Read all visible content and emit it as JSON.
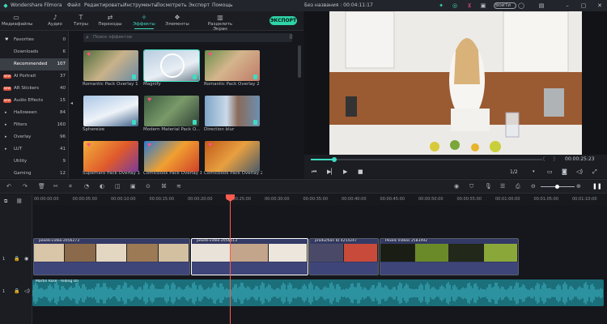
{
  "app": {
    "name": "Wondershare Filmora",
    "logo": "filmora-logo-icon"
  },
  "menu": [
    "Файл",
    "Редактировать",
    "Инструменты",
    "Посмотреть",
    "Экспорт",
    "Помощь"
  ],
  "project": {
    "title": "Без названия : 00:04:11:17"
  },
  "titlebar": {
    "login_label": "Войти"
  },
  "tabs": [
    {
      "label": "Медиафайлы",
      "icon": "folder-icon"
    },
    {
      "label": "Аудио",
      "icon": "music-note-icon"
    },
    {
      "label": "Титры",
      "icon": "text-icon"
    },
    {
      "label": "Переходы",
      "icon": "transition-icon"
    },
    {
      "label": "Эффекты",
      "icon": "effects-icon"
    },
    {
      "label": "Элементы",
      "icon": "elements-icon"
    },
    {
      "label": "Разделить Экран",
      "icon": "split-screen-icon"
    }
  ],
  "export_label": "ЭКСПОРТ",
  "categories": [
    {
      "name": "Favorites",
      "count": "0",
      "icon": "heart-icon"
    },
    {
      "name": "Downloads",
      "count": "6"
    },
    {
      "name": "Recommended",
      "count": "107"
    },
    {
      "name": "AI Portrait",
      "count": "37",
      "badge": "NEW"
    },
    {
      "name": "AR Stickers",
      "count": "40",
      "badge": "NEW"
    },
    {
      "name": "Audio Effects",
      "count": "15",
      "badge": "NEW"
    },
    {
      "name": "Halloween",
      "count": "84"
    },
    {
      "name": "Filters",
      "count": "160"
    },
    {
      "name": "Overlay",
      "count": "96"
    },
    {
      "name": "LUT",
      "count": "41"
    },
    {
      "name": "Utility",
      "count": "9"
    },
    {
      "name": "Gaming",
      "count": "12"
    }
  ],
  "search": {
    "placeholder": "Поиск эффектов"
  },
  "effects": [
    {
      "label": "Romantic Pack Overlay 1"
    },
    {
      "label": "Magnify"
    },
    {
      "label": "Romantic Pack Overlay 2"
    },
    {
      "label": "Sphereize"
    },
    {
      "label": "Modern Material Pack O..."
    },
    {
      "label": "Direction blur"
    },
    {
      "label": "Superhero Pack Overlay 1"
    },
    {
      "label": "Comicbook Pack Overlay 1"
    },
    {
      "label": "Comicbook Pack Overlay 2"
    }
  ],
  "preview": {
    "timecode": "00:00:25:23",
    "ratio": "1/2",
    "progress": 0.1
  },
  "ruler": [
    "00:00:00:00",
    "00:00:05:00",
    "00:00:10:00",
    "00:00:15:00",
    "00:00:20:00",
    "00:00:25:00",
    "00:00:30:00",
    "00:00:35:00",
    "00:00:40:00",
    "00:00:45:00",
    "00:00:50:00",
    "00:00:55:00",
    "00:01:00:00",
    "00:01:05:00",
    "00:01:10:00"
  ],
  "clips": [
    {
      "label": "pexels-video-2056273"
    },
    {
      "label": "pexels-video-2056513"
    },
    {
      "label": "production ID 4254247"
    },
    {
      "label": "Pexels Videos 2583492"
    }
  ],
  "audio_clip": {
    "label": "Martin Rose - Riding On"
  },
  "track_labels": {
    "video": "1",
    "audio": "1"
  },
  "colors": {
    "accent": "#3ddcc0",
    "playhead": "#ff5a4e",
    "audio": "#1b6f7a"
  }
}
